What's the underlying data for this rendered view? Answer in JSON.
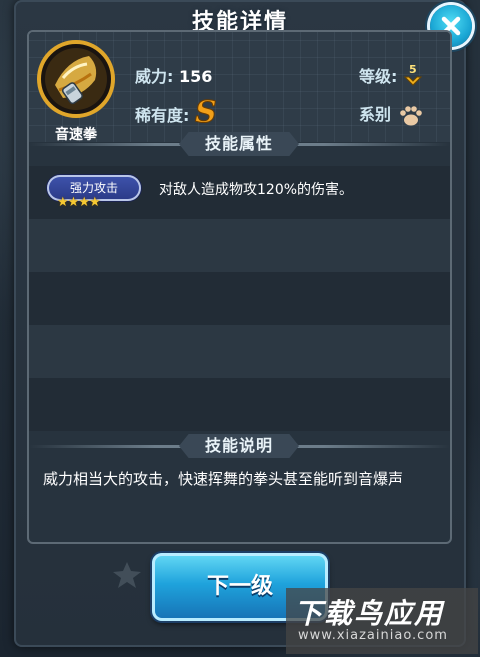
{
  "dialog": {
    "title": "技能详情",
    "close_icon": "close-x-icon"
  },
  "skill": {
    "name": "音速拳",
    "icon": "fist-skill-icon",
    "power_label": "威力:",
    "power_value": "156",
    "level_label": "等级:",
    "level_value": "5",
    "rarity_label": "稀有度:",
    "rarity_value": "S",
    "type_label": "系别",
    "type_icon": "paw-icon"
  },
  "attributes": {
    "section_title": "技能属性",
    "items": [
      {
        "badge": "强力攻击",
        "stars": 4,
        "text": "对敌人造成物攻120%的伤害。"
      }
    ]
  },
  "description": {
    "section_title": "技能说明",
    "text": "威力相当大的攻击，快速挥舞的拳头甚至能听到音爆声"
  },
  "actions": {
    "next_label": "下一级"
  },
  "watermark": {
    "big": "下载鸟应用",
    "small": "www.xiazainiao.com"
  },
  "colors": {
    "accent_blue": "#1fa3dc",
    "rarity_gold": "#f2a019",
    "badge_blue": "#2a3a86"
  }
}
